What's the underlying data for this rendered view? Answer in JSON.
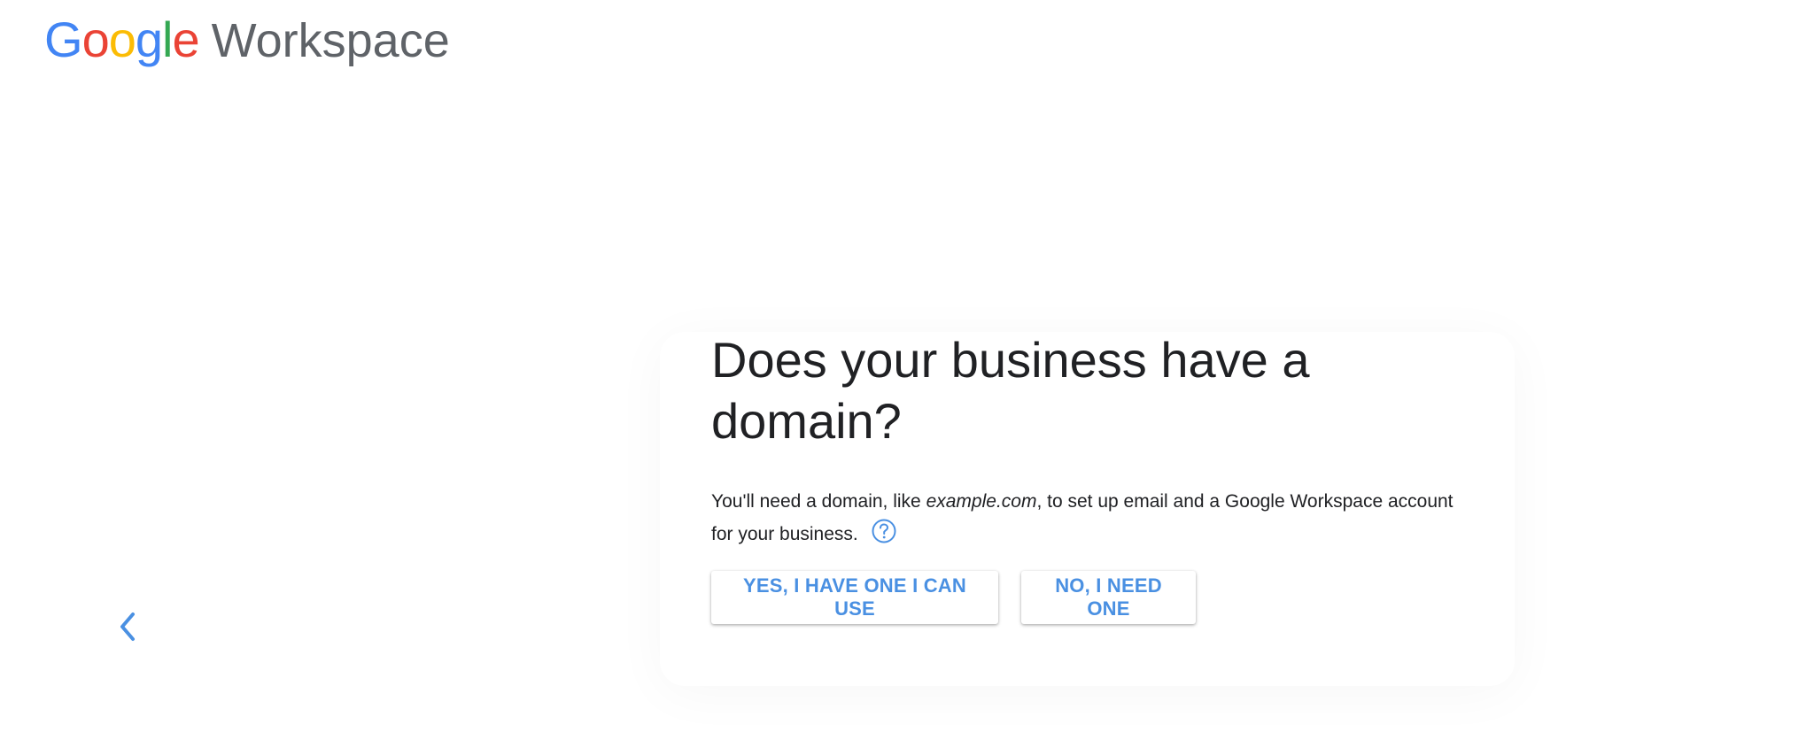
{
  "header": {
    "logo": {
      "letters": [
        {
          "char": "G",
          "color": "#4285F4"
        },
        {
          "char": "o",
          "color": "#EA4335"
        },
        {
          "char": "o",
          "color": "#FBBC05"
        },
        {
          "char": "g",
          "color": "#4285F4"
        },
        {
          "char": "l",
          "color": "#34A853"
        },
        {
          "char": "e",
          "color": "#EA4335"
        }
      ],
      "product": "Workspace"
    }
  },
  "main": {
    "headline": "Does your business have a domain?",
    "description_before": "You'll need a domain, like ",
    "description_example": "example.com",
    "description_after": ", to set up email and a Google Workspace account for your business.",
    "help_icon": "help-circle-icon",
    "buttons": {
      "yes_label": "YES, I HAVE ONE I CAN USE",
      "no_label": "NO, I NEED ONE"
    }
  },
  "navigation": {
    "back_icon": "chevron-left-icon"
  },
  "colors": {
    "accent": "#4a90e2",
    "text": "#202124",
    "logo_gray": "#5f6368"
  }
}
